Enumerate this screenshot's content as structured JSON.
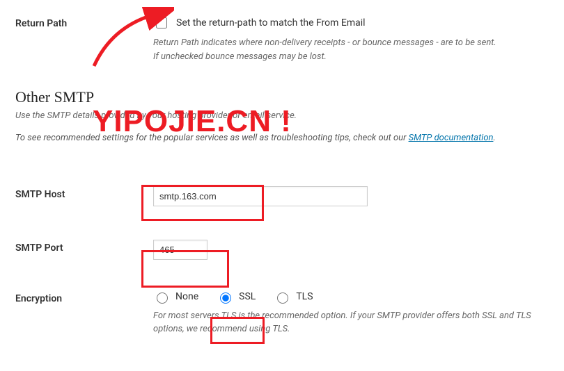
{
  "returnPath": {
    "label": "Return Path",
    "checkboxLabel": "Set the return-path to match the From Email",
    "desc1": "Return Path indicates where non-delivery receipts - or bounce messages - are to be sent.",
    "desc2": "If unchecked bounce messages may be lost."
  },
  "otherSmtp": {
    "heading": "Other SMTP",
    "subdesc": "Use the SMTP details provided by your hosting provider or email service.",
    "linkLinePrefix": "To see recommended settings for the popular services as well as troubleshooting tips, check out our ",
    "linkText": "SMTP documentation",
    "linkLineSuffix": "."
  },
  "smtpHost": {
    "label": "SMTP Host",
    "value": "smtp.163.com"
  },
  "smtpPort": {
    "label": "SMTP Port",
    "value": "465"
  },
  "encryption": {
    "label": "Encryption",
    "options": {
      "none": "None",
      "ssl": "SSL",
      "tls": "TLS"
    },
    "selected": "ssl",
    "desc": "For most servers TLS is the recommended option. If your SMTP provider offers both SSL and TLS options, we recommend using TLS."
  },
  "watermark": "YIPOJIE.CN !"
}
